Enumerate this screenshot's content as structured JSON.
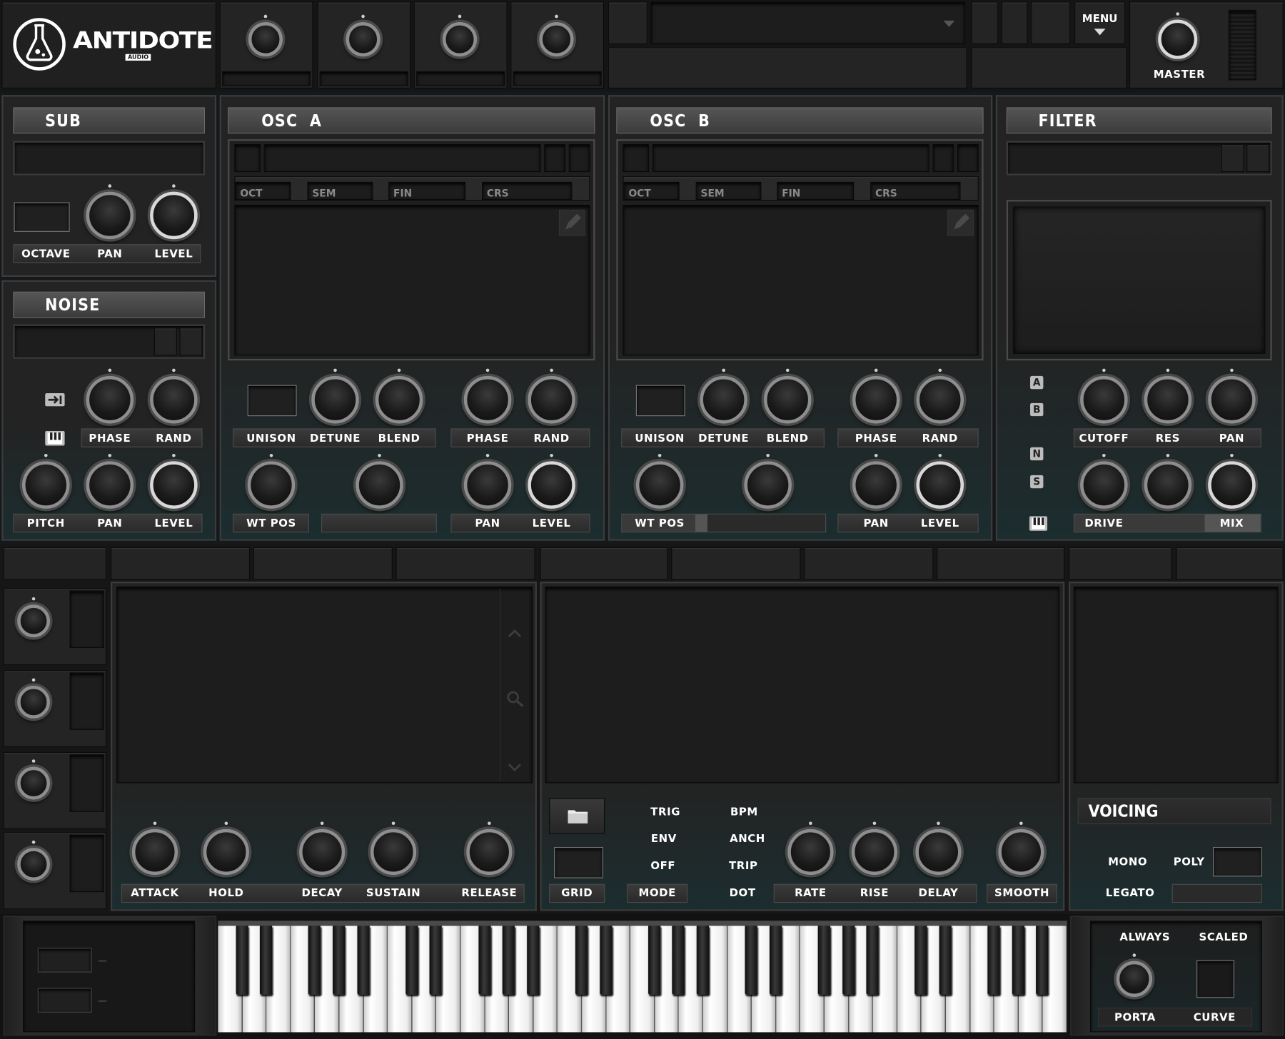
{
  "app": {
    "brand": "ANTIDOTE",
    "brand_sub": "AUDIO"
  },
  "header": {
    "menu_label": "MENU",
    "master_label": "MASTER"
  },
  "sub": {
    "title": "SUB",
    "labels": [
      "OCTAVE",
      "PAN",
      "LEVEL"
    ]
  },
  "noise": {
    "title": "NOISE",
    "row1_labels": [
      "PHASE",
      "RAND"
    ],
    "row2_labels": [
      "PITCH",
      "PAN",
      "LEVEL"
    ]
  },
  "osc_a": {
    "title": "OSC  A",
    "pitch_labels": [
      "OCT",
      "SEM",
      "FIN",
      "CRS"
    ],
    "row1_left_labels": [
      "UNISON",
      "DETUNE",
      "BLEND"
    ],
    "row1_right_labels": [
      "PHASE",
      "RAND"
    ],
    "wt_pos_label": "WT POS",
    "row2_right_labels": [
      "PAN",
      "LEVEL"
    ]
  },
  "osc_b": {
    "title": "OSC  B",
    "pitch_labels": [
      "OCT",
      "SEM",
      "FIN",
      "CRS"
    ],
    "row1_left_labels": [
      "UNISON",
      "DETUNE",
      "BLEND"
    ],
    "row1_right_labels": [
      "PHASE",
      "RAND"
    ],
    "wt_pos_label": "WT POS",
    "row2_right_labels": [
      "PAN",
      "LEVEL"
    ]
  },
  "filter": {
    "title": "FILTER",
    "routing": [
      "A",
      "B",
      "N",
      "S"
    ],
    "row1_labels": [
      "CUTOFF",
      "RES",
      "PAN"
    ],
    "row2_labels": [
      "DRIVE",
      "MIX"
    ]
  },
  "envelope": {
    "labels": [
      "ATTACK",
      "HOLD",
      "DECAY",
      "SUSTAIN",
      "RELEASE"
    ]
  },
  "lfo": {
    "grid_label": "GRID",
    "mode_label": "MODE",
    "mode_options": [
      "TRIG",
      "ENV",
      "OFF"
    ],
    "sync_options": [
      "BPM",
      "ANCH",
      "TRIP",
      "DOT"
    ],
    "knob_labels": [
      "RATE",
      "RISE",
      "DELAY",
      "SMOOTH"
    ]
  },
  "voicing": {
    "title": "VOICING",
    "options": [
      "MONO",
      "POLY",
      "LEGATO"
    ]
  },
  "porta": {
    "top_labels": [
      "ALWAYS",
      "SCALED"
    ],
    "labels": [
      "PORTA",
      "CURVE"
    ]
  },
  "colors": {
    "panel_gradient_bottom": "#1c2d2f",
    "label_bar": "#333333",
    "header": "#4a4a4a",
    "knob_ring": "#8d8d8d"
  }
}
